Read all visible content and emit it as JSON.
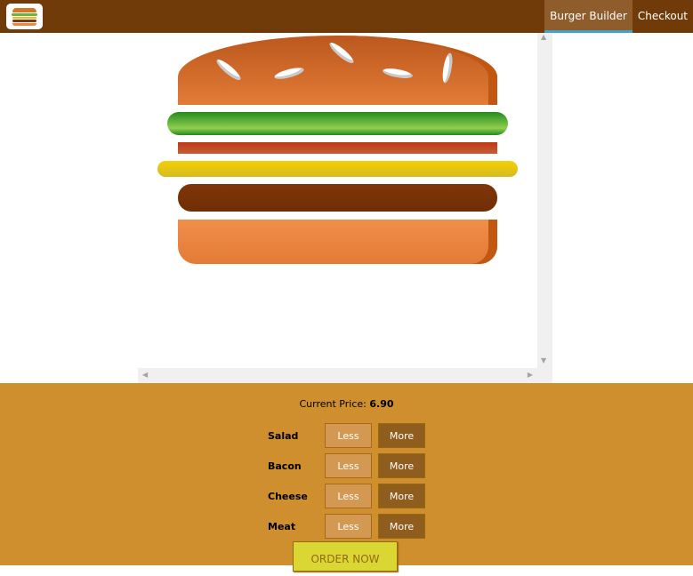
{
  "nav": {
    "logo_alt": "burger-logo-icon",
    "items": [
      {
        "label": "Burger Builder",
        "active": true
      },
      {
        "label": "Checkout",
        "active": false
      }
    ]
  },
  "burger": {
    "ingredients": [
      "bread-top",
      "salad",
      "bacon",
      "cheese",
      "meat",
      "bread-bottom"
    ]
  },
  "controls": {
    "price_label": "Current Price:",
    "price_value": "6.90",
    "rows": [
      {
        "label": "Salad",
        "less": "Less",
        "more": "More"
      },
      {
        "label": "Bacon",
        "less": "Less",
        "more": "More"
      },
      {
        "label": "Cheese",
        "less": "Less",
        "more": "More"
      },
      {
        "label": "Meat",
        "less": "Less",
        "more": "More"
      }
    ],
    "order_label": "ORDER NOW"
  },
  "colors": {
    "toolbar": "#703B09",
    "active_nav": "#8F5C2C",
    "active_underline": "#40A4C8",
    "controls_bg": "#CF8F2E",
    "order_button": "#DAD735"
  }
}
